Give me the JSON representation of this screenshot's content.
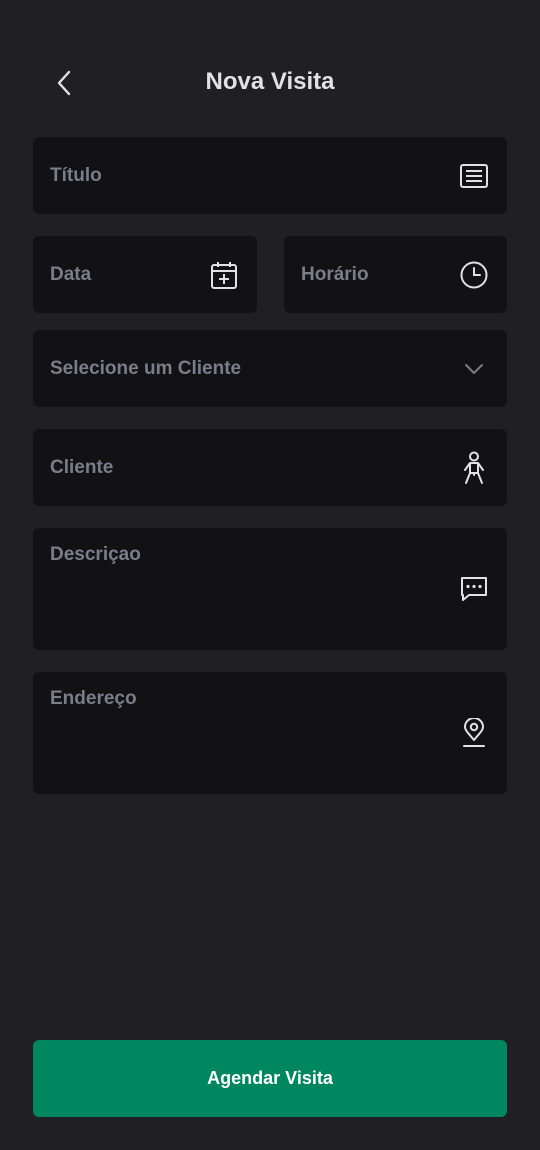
{
  "header": {
    "title": "Nova Visita",
    "back_icon": "chevron-left-icon"
  },
  "form": {
    "title": {
      "placeholder": "Título",
      "value": "",
      "icon": "document-lines-icon"
    },
    "date": {
      "placeholder": "Data",
      "value": "",
      "icon": "calendar-plus-icon"
    },
    "time": {
      "placeholder": "Horário",
      "value": "",
      "icon": "clock-icon"
    },
    "client_select": {
      "placeholder": "Selecione um Cliente",
      "selected": "",
      "icon": "chevron-down-icon"
    },
    "client": {
      "placeholder": "Cliente",
      "value": "",
      "icon": "person-icon"
    },
    "description": {
      "placeholder": "Descriçao",
      "value": "",
      "icon": "chat-dots-icon"
    },
    "address": {
      "placeholder": "Endereço",
      "value": "",
      "icon": "map-pin-icon"
    }
  },
  "actions": {
    "submit_label": "Agendar Visita"
  },
  "colors": {
    "background": "#202024",
    "field_background": "#121214",
    "placeholder": "#7c7c8a",
    "text": "#e1e1e6",
    "accent": "#00875f"
  }
}
